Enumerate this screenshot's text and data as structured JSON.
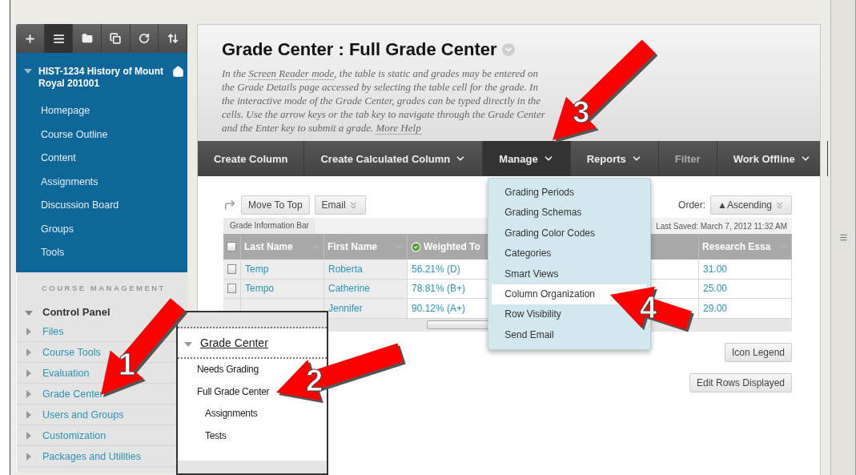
{
  "sidebar": {
    "tools": [
      {
        "kind": "add",
        "selected": false
      },
      {
        "kind": "list",
        "selected": true
      },
      {
        "kind": "folder",
        "selected": false
      },
      {
        "kind": "windows",
        "selected": false
      },
      {
        "kind": "refresh",
        "selected": false
      },
      {
        "kind": "sort",
        "selected": false
      }
    ],
    "course": {
      "title": "HIST-1234 History of Mount Royal 201001",
      "expanded": true,
      "items": [
        "Homepage",
        "Course Outline",
        "Content",
        "Assignments",
        "Discussion Board",
        "Groups",
        "Tools"
      ]
    },
    "management": {
      "heading": "COURSE MANAGEMENT",
      "panel": "Control Panel",
      "expanded": true,
      "items": [
        {
          "label": "Files",
          "expanded": false
        },
        {
          "label": "Course Tools",
          "expanded": false
        },
        {
          "label": "Evaluation",
          "expanded": false
        },
        {
          "label": "Grade Center",
          "expanded": false
        },
        {
          "label": "Users and Groups",
          "expanded": false
        },
        {
          "label": "Customization",
          "expanded": false
        },
        {
          "label": "Packages and Utilities",
          "expanded": false
        }
      ]
    }
  },
  "page": {
    "title": "Grade Center : Full Grade Center",
    "description": [
      {
        "text": "In the ",
        "link": false
      },
      {
        "text": "Screen Reader mode",
        "link": true
      },
      {
        "text": ", the table is static and grades may be entered on the Grade Details page accessed by selecting the table cell for the grade. In the interactive mode of the Grade Center, grades can be typed directly in the cells. Use the arrow keys or the tab key to navigate through the Grade Center and the Enter key to submit a grade. ",
        "link": false
      },
      {
        "text": "More Help",
        "link": true
      }
    ]
  },
  "toolbar": [
    {
      "label": "Create Column",
      "dropdown": false,
      "selected": false,
      "disabled": false
    },
    {
      "label": "Create Calculated Column",
      "dropdown": true,
      "selected": false,
      "disabled": false
    },
    {
      "label": "Manage",
      "dropdown": true,
      "selected": true,
      "disabled": false
    },
    {
      "label": "Reports",
      "dropdown": true,
      "selected": false,
      "disabled": false
    },
    {
      "label": "Filter",
      "dropdown": false,
      "selected": false,
      "disabled": true
    },
    {
      "label": "Work Offline",
      "dropdown": true,
      "selected": false,
      "disabled": false
    }
  ],
  "manage_menu": [
    {
      "label": "Grading Periods",
      "selected": false
    },
    {
      "label": "Grading Schemas",
      "selected": false
    },
    {
      "label": "Grading Color Codes",
      "selected": false
    },
    {
      "label": "Categories",
      "selected": false
    },
    {
      "label": "Smart Views",
      "selected": false
    },
    {
      "label": "Column Organization",
      "selected": true
    },
    {
      "label": "Row Visibility",
      "selected": false
    },
    {
      "label": "Send Email",
      "selected": false
    }
  ],
  "actions": {
    "buttons": [
      {
        "label": "Move To Top",
        "dropdown": false
      },
      {
        "label": "Email",
        "dropdown": true
      }
    ],
    "order_label": "Order:",
    "order": "▲Ascending"
  },
  "info_bar": {
    "tab": "Grade Information Bar",
    "status": "Last Saved: March 7, 2012 11:32 AM"
  },
  "table": {
    "all_checked": false,
    "columns": [
      {
        "label": "Last Name",
        "kind": "name"
      },
      {
        "label": "First Name",
        "kind": "name"
      },
      {
        "label": "Weighted To",
        "kind": "weighted"
      },
      {
        "label": "Research Essa",
        "kind": "grade"
      }
    ],
    "rows": [
      {
        "checked": false,
        "last_name": "Temp",
        "first_name": "Roberta",
        "weighted": "56.21% (D)",
        "research": "31.00"
      },
      {
        "checked": false,
        "last_name": "Tempo",
        "first_name": "Catherine",
        "weighted": "78.81% (B+)",
        "research": "25.00"
      },
      {
        "first_name": "Jennifer",
        "weighted": "90.12% (A+)",
        "research": "29.00"
      }
    ]
  },
  "buttons": [
    "Icon Legend",
    "Edit Rows Displayed"
  ],
  "inset": {
    "title": "Grade Center",
    "expanded": true,
    "items": [
      {
        "label": "Needs Grading"
      },
      {
        "label": "Full Grade Center",
        "children": [
          {
            "label": "Assignments"
          },
          {
            "label": "Tests"
          }
        ]
      }
    ]
  },
  "callouts": [
    {
      "label": "1"
    },
    {
      "label": "2"
    },
    {
      "label": "3"
    },
    {
      "label": "4"
    }
  ]
}
